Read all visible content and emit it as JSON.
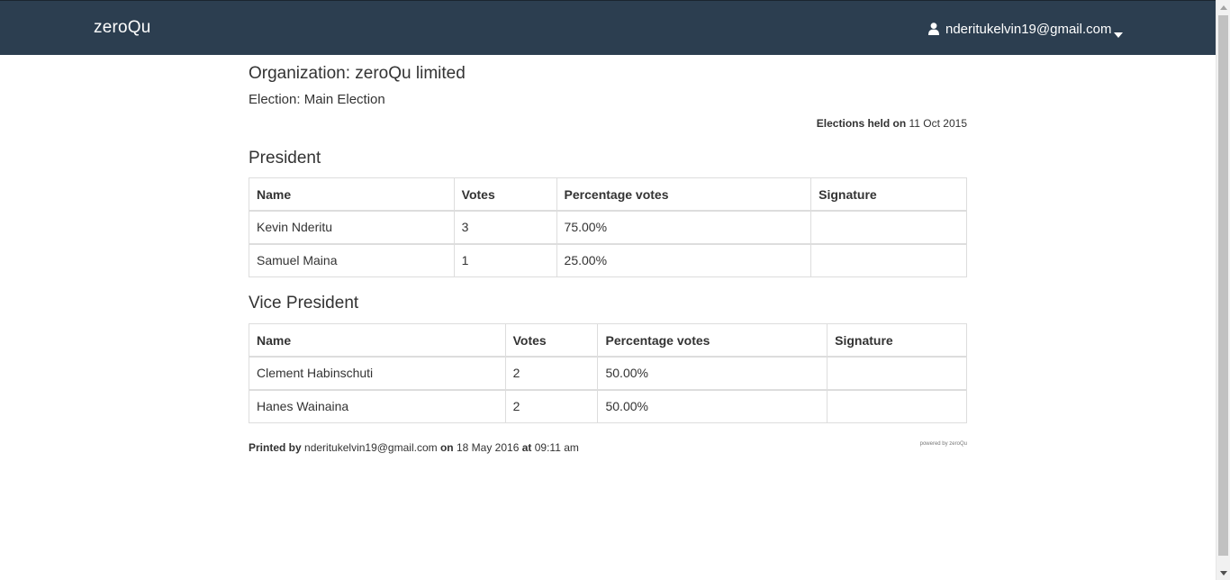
{
  "navbar": {
    "brand": "zeroQu",
    "user_email": "nderitukelvin19@gmail.com"
  },
  "header": {
    "organization": "Organization: zeroQu limited",
    "election": "Election: Main Election",
    "held_label": "Elections held on",
    "held_date": "11 Oct 2015"
  },
  "columns": {
    "name": "Name",
    "votes": "Votes",
    "percentage": "Percentage votes",
    "signature": "Signature"
  },
  "positions": [
    {
      "title": "President",
      "candidates": [
        {
          "name": "Kevin Nderitu",
          "votes": "3",
          "percentage": "75.00%",
          "signature": ""
        },
        {
          "name": "Samuel Maina",
          "votes": "1",
          "percentage": "25.00%",
          "signature": ""
        }
      ]
    },
    {
      "title": "Vice President",
      "candidates": [
        {
          "name": "Clement Habinschuti",
          "votes": "2",
          "percentage": "50.00%",
          "signature": ""
        },
        {
          "name": "Hanes Wainaina",
          "votes": "2",
          "percentage": "50.00%",
          "signature": ""
        }
      ]
    }
  ],
  "footer": {
    "printed_label": "Printed by",
    "printed_by": "nderitukelvin19@gmail.com",
    "on_label": "on",
    "printed_date": "18 May 2016",
    "at_label": "at",
    "printed_time": "09:11 am",
    "powered_by": "powered by zeroQu"
  },
  "icons": {
    "user": "user-icon",
    "caret": "caret-down-icon"
  },
  "colors": {
    "navbar_bg": "#2c3e50",
    "border": "#dddddd"
  }
}
